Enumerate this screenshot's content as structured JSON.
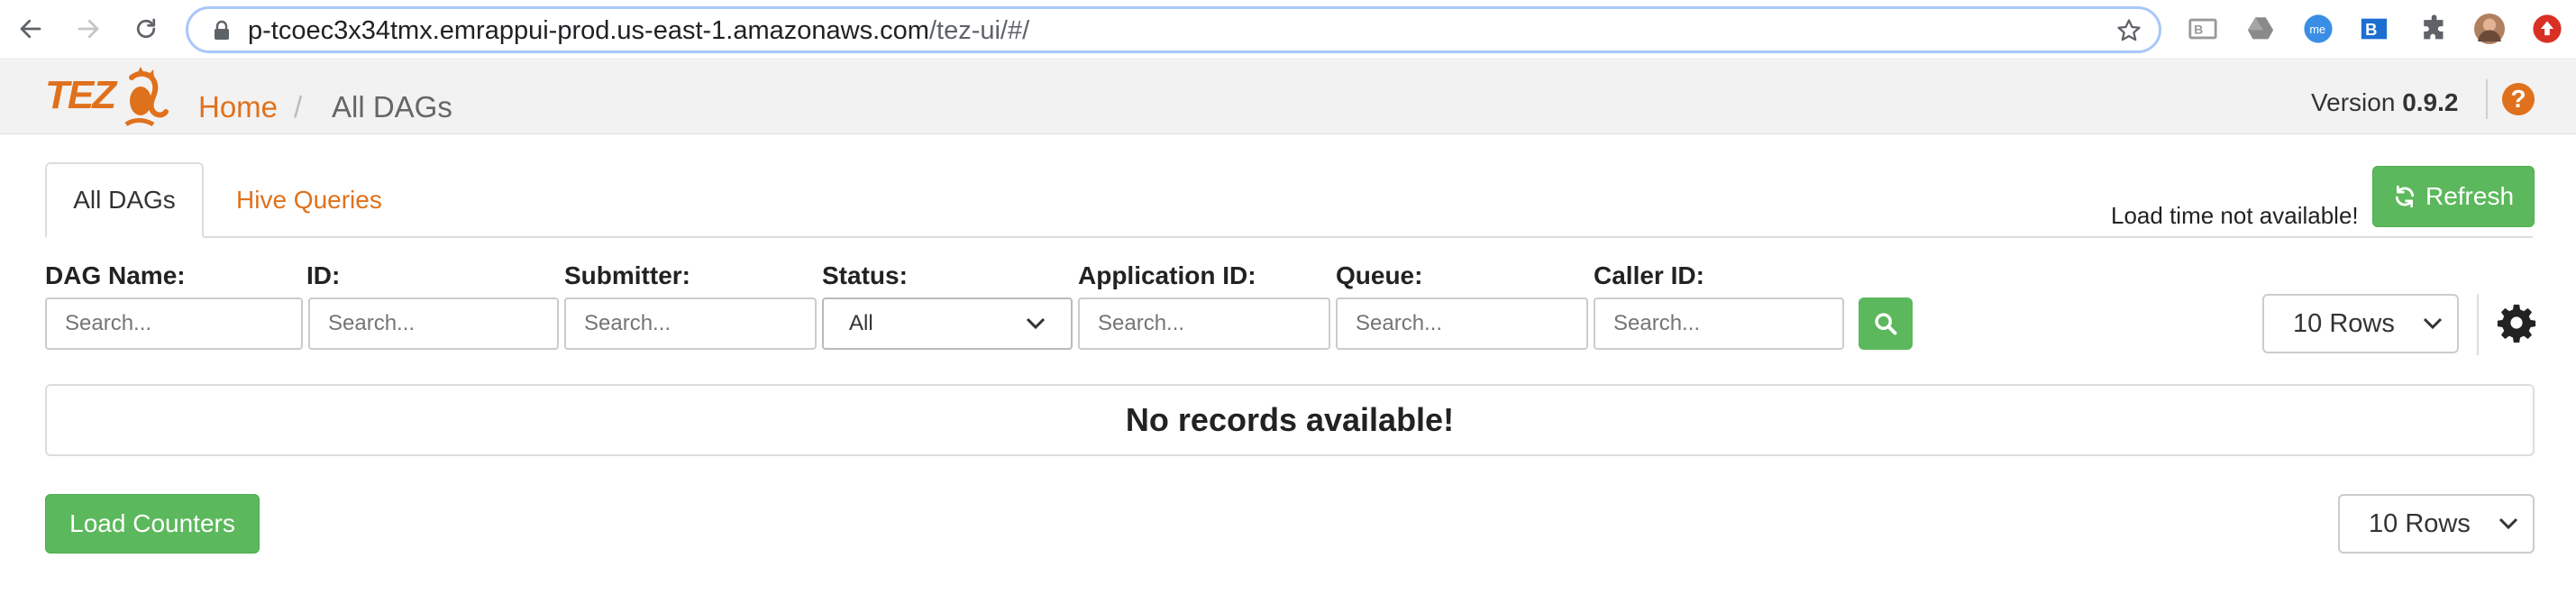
{
  "browser": {
    "url_host": "p-tcoec3x34tmx.emrappui-prod.us-east-1.amazonaws.com",
    "url_path": "/tez-ui/#/",
    "extensions": [
      "bi-extension-icon",
      "drive-extension-icon",
      "me-extension-icon",
      "bi-blue-extension-icon",
      "puzzle-extensions-icon",
      "profile-avatar",
      "update-icon"
    ]
  },
  "header": {
    "logo_text": "TEZ",
    "breadcrumb_home": "Home",
    "breadcrumb_sep": "/",
    "breadcrumb_current": "All DAGs",
    "version_label": "Version",
    "version_value": "0.9.2",
    "help_glyph": "?"
  },
  "tabs": {
    "active": "All DAGs",
    "hive": "Hive Queries"
  },
  "toolbar": {
    "load_time": "Load time not available!",
    "refresh_label": "Refresh"
  },
  "filters": {
    "dag_name_label": "DAG Name:",
    "id_label": "ID:",
    "submitter_label": "Submitter:",
    "status_label": "Status:",
    "app_id_label": "Application ID:",
    "queue_label": "Queue:",
    "caller_id_label": "Caller ID:",
    "placeholder": "Search...",
    "status_value": "All"
  },
  "table": {
    "rows_per_page": "10 Rows",
    "empty_message": "No records available!"
  },
  "footer": {
    "load_counters_label": "Load Counters",
    "rows_per_page": "10 Rows"
  },
  "colors": {
    "accent": "#e0711c",
    "button_green": "#5cb85c",
    "header_bg": "#f2f2f2"
  }
}
